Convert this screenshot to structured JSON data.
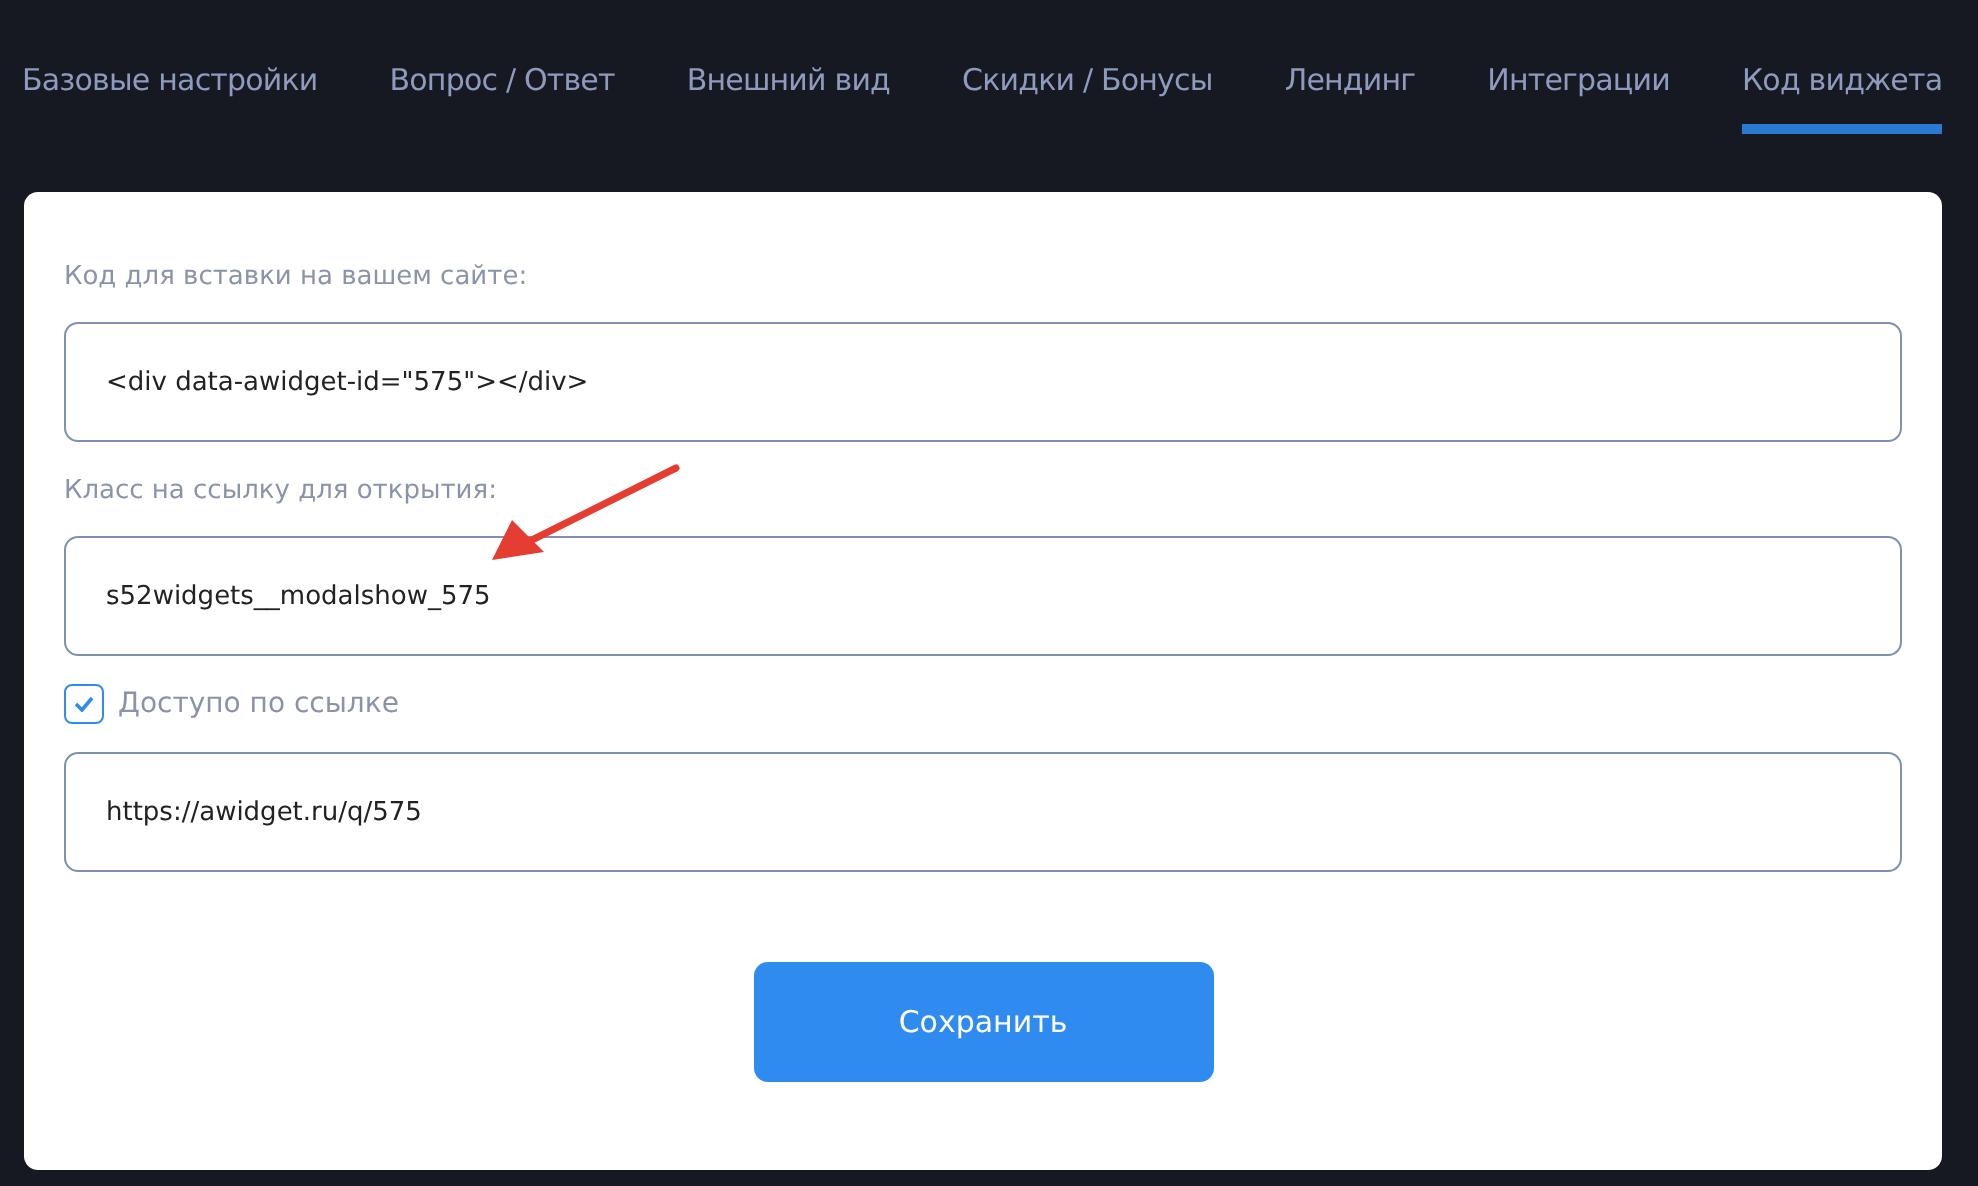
{
  "tabs": [
    {
      "label": "Базовые настройки",
      "selected": false
    },
    {
      "label": "Вопрос / Ответ",
      "selected": false
    },
    {
      "label": "Внешний вид",
      "selected": false
    },
    {
      "label": "Скидки / Бонусы",
      "selected": false
    },
    {
      "label": "Лендинг",
      "selected": false
    },
    {
      "label": "Интеграции",
      "selected": false
    },
    {
      "label": "Код виджета",
      "selected": true
    }
  ],
  "form": {
    "embed_code": {
      "label": "Код для вставки на вашем сайте:",
      "value": "<div data-awidget-id=\"575\"></div>"
    },
    "link_class": {
      "label": "Класс на ссылку для открытия:",
      "value": "s52widgets__modalshow_575"
    },
    "link_access": {
      "label": "Доступо по ссылке",
      "checked": true
    },
    "link_url": {
      "value": "https://awidget.ru/q/575"
    },
    "save_button": "Сохранить"
  }
}
